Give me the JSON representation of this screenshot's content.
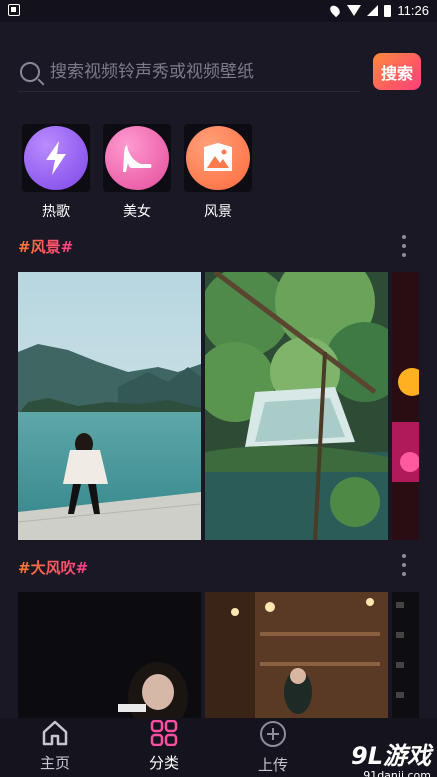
{
  "status_bar": {
    "time": "11:26"
  },
  "search": {
    "placeholder": "搜索视频铃声秀或视频壁纸",
    "button_label": "搜索"
  },
  "categories": [
    {
      "label": "热歌",
      "icon": "lightning-icon",
      "color": "#9a5cf0"
    },
    {
      "label": "美女",
      "icon": "high-heel-icon",
      "color": "#ef5aa8"
    },
    {
      "label": "风景",
      "icon": "landscape-icon",
      "color": "#ff7a4d"
    }
  ],
  "sections": [
    {
      "title": "#风景#"
    },
    {
      "title": "#大风吹#"
    }
  ],
  "tabs": [
    {
      "label": "主页",
      "icon": "home-icon"
    },
    {
      "label": "分类",
      "icon": "grid-icon"
    },
    {
      "label": "上传",
      "icon": "upload-plus-icon"
    }
  ],
  "watermark": {
    "logo": "9L游戏",
    "url": "91danji.com"
  }
}
